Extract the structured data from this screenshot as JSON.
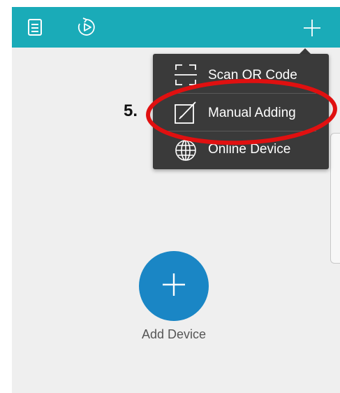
{
  "topbar": {
    "color": "#1aabb8",
    "left_icons": [
      "list-icon",
      "replay-icon"
    ],
    "right_icon": "plus-icon"
  },
  "dropdown": {
    "items": [
      {
        "label": "Scan QR Code",
        "icon": "scan-qr-icon"
      },
      {
        "label": "Manual Adding",
        "icon": "edit-icon"
      },
      {
        "label": "Online Device",
        "icon": "globe-icon"
      }
    ]
  },
  "main": {
    "add_device_label": "Add Device",
    "fab_color": "#1a86c5"
  },
  "annotation": {
    "step": "5.",
    "highlight_color": "#e01010"
  }
}
